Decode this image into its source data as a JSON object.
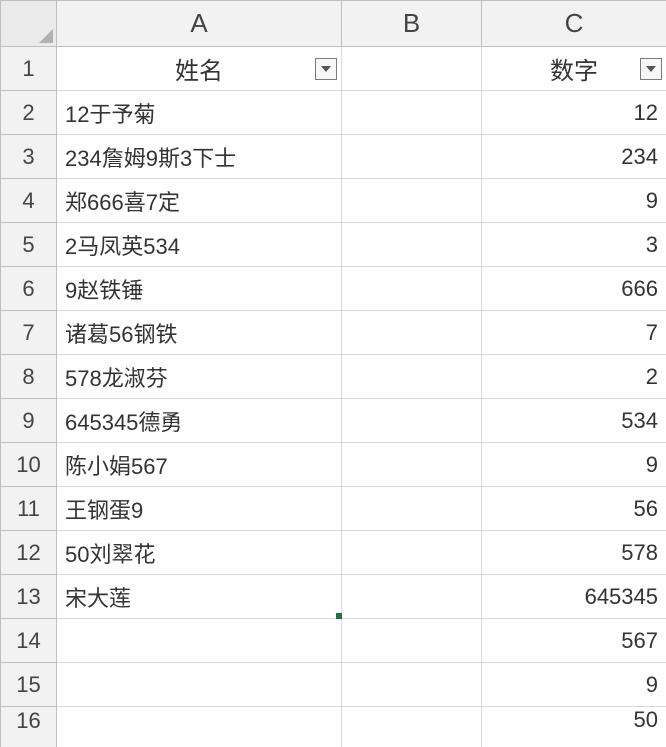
{
  "columns": {
    "A": "A",
    "B": "B",
    "C": "C"
  },
  "rownums": [
    "1",
    "2",
    "3",
    "4",
    "5",
    "6",
    "7",
    "8",
    "9",
    "10",
    "11",
    "12",
    "13",
    "14",
    "15",
    "16"
  ],
  "headers": {
    "colA": "姓名",
    "colC": "数字"
  },
  "colA_data": [
    "12于予菊",
    "234詹姆9斯3下士",
    "郑666喜7定",
    "2马凤英534",
    "9赵铁锤",
    "诸葛56钢铁",
    "578龙淑芬",
    "645345德勇",
    "陈小娟567",
    "王钢蛋9",
    "50刘翠花",
    "宋大莲"
  ],
  "colC_data": [
    "12",
    "234",
    "9",
    "3",
    "666",
    "7",
    "2",
    "534",
    "9",
    "56",
    "578",
    "645345",
    "567",
    "9",
    "50"
  ]
}
